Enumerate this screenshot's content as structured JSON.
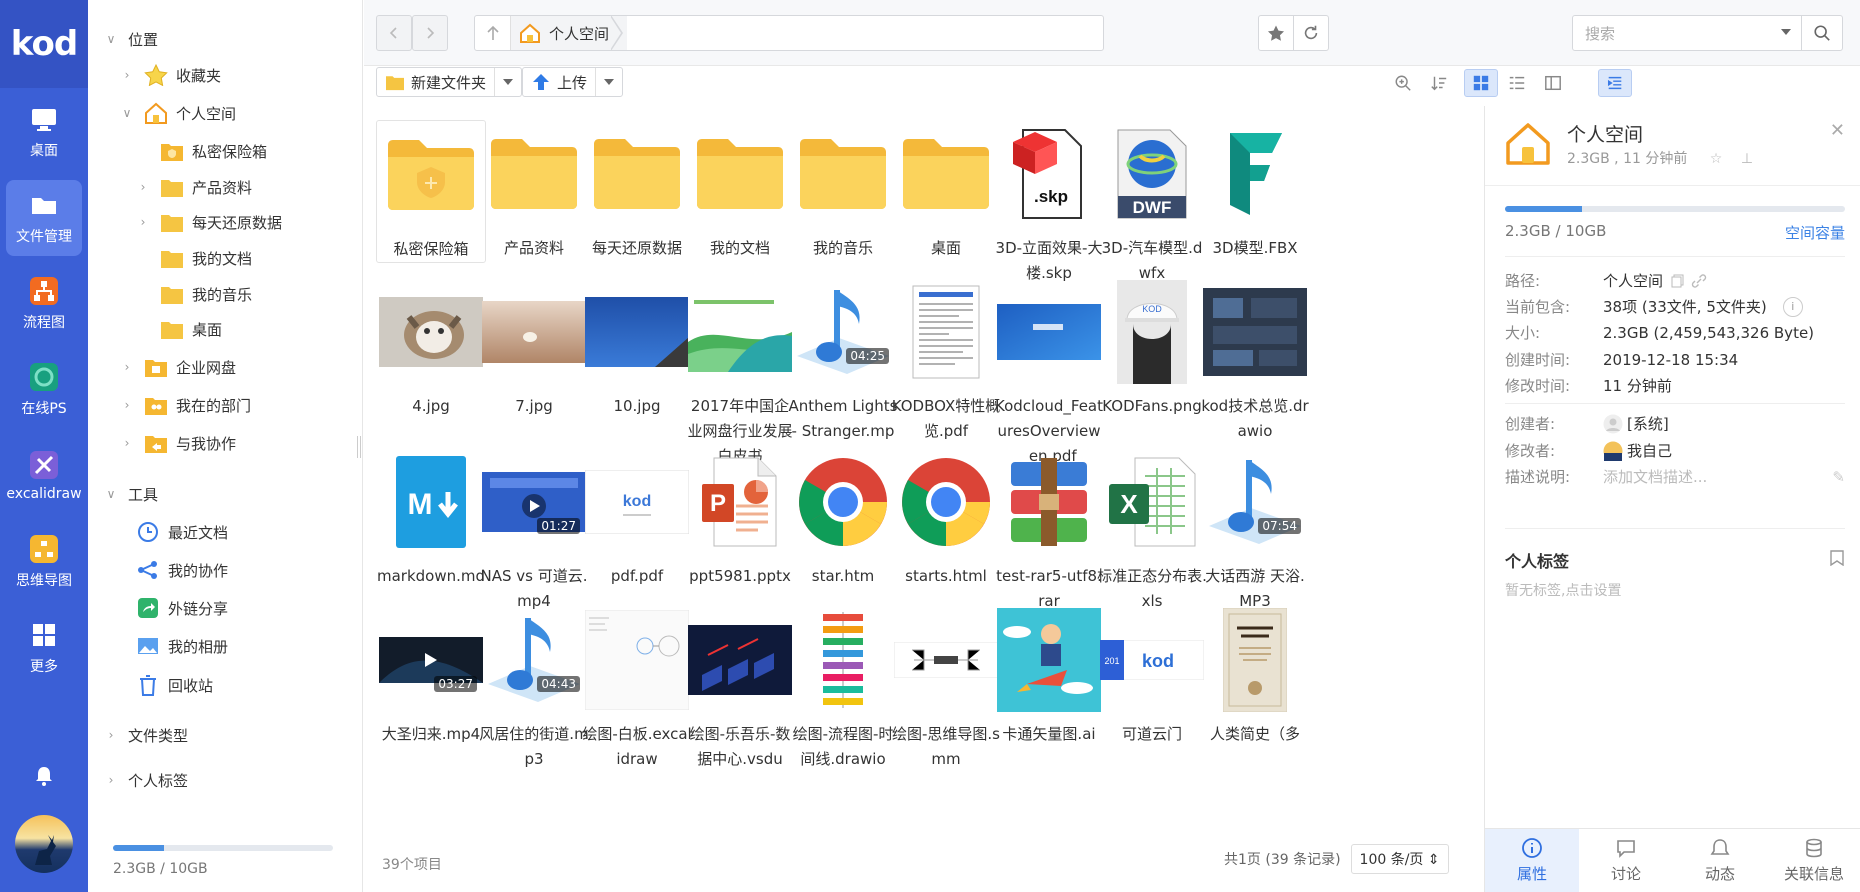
{
  "app": {
    "logo": "kod"
  },
  "appnav": {
    "items": [
      {
        "label": "桌面",
        "icon": "monitor-icon"
      },
      {
        "label": "文件管理",
        "icon": "folder-icon",
        "active": true
      },
      {
        "label": "流程图",
        "icon": "flowchart-icon"
      },
      {
        "label": "在线PS",
        "icon": "photoshop-icon"
      },
      {
        "label": "excalidraw",
        "icon": "excalidraw-icon"
      },
      {
        "label": "思维导图",
        "icon": "mindmap-icon"
      },
      {
        "label": "更多",
        "icon": "grid-icon"
      }
    ]
  },
  "tree": {
    "location_header": "位置",
    "favorites": "收藏夹",
    "personal_space": "个人空间",
    "children": [
      "私密保险箱",
      "产品资料",
      "每天还原数据",
      "我的文档",
      "我的音乐",
      "桌面"
    ],
    "enterprise_disk": "企业网盘",
    "my_department": "我在的部门",
    "collaborate_with_me": "与我协作",
    "tools_header": "工具",
    "tools": [
      "最近文档",
      "我的协作",
      "外链分享",
      "我的相册",
      "回收站"
    ],
    "file_types": "文件类型",
    "personal_tags": "个人标签",
    "quota_text": "2.3GB / 10GB",
    "quota_used_fraction": 0.23
  },
  "topbar": {
    "breadcrumb": "个人空间",
    "search_placeholder": "搜索"
  },
  "toolbar": {
    "new_folder": "新建文件夹",
    "upload": "上传"
  },
  "files": [
    {
      "name": "私密保险箱",
      "kind": "safe-folder"
    },
    {
      "name": "产品资料",
      "kind": "folder"
    },
    {
      "name": "每天还原数据",
      "kind": "folder"
    },
    {
      "name": "我的文档",
      "kind": "folder"
    },
    {
      "name": "我的音乐",
      "kind": "folder"
    },
    {
      "name": "桌面",
      "kind": "folder"
    },
    {
      "name": "3D-立面效果-大楼.skp",
      "kind": "skp"
    },
    {
      "name": "3D-汽车模型.dwfx",
      "kind": "dwf"
    },
    {
      "name": "3D模型.FBX",
      "kind": "fbx"
    },
    {
      "name": "4.jpg",
      "kind": "img-cat"
    },
    {
      "name": "7.jpg",
      "kind": "img-beach"
    },
    {
      "name": "10.jpg",
      "kind": "img-sky"
    },
    {
      "name": "2017年中国企业网盘行业发展白皮书",
      "kind": "img-report"
    },
    {
      "name": "Anthem Lights - Stranger.mp",
      "kind": "music",
      "badge": "04:25"
    },
    {
      "name": "KODBOX特性概览.pdf",
      "kind": "doc"
    },
    {
      "name": "Kodcloud_FeaturesOverview_en.pdf",
      "kind": "img-blue"
    },
    {
      "name": "KODFans.png",
      "kind": "img-hat"
    },
    {
      "name": "kod技术总览.drawio",
      "kind": "img-dark"
    },
    {
      "name": "markdown.md",
      "kind": "md"
    },
    {
      "name": "NAS vs 可道云.mp4",
      "kind": "video-blue",
      "badge": "01:27"
    },
    {
      "name": "pdf.pdf",
      "kind": "img-kod"
    },
    {
      "name": "ppt5981.pptx",
      "kind": "ppt"
    },
    {
      "name": "star.htm",
      "kind": "chrome"
    },
    {
      "name": "starts.html",
      "kind": "chrome"
    },
    {
      "name": "test-rar5-utf8.rar",
      "kind": "rar"
    },
    {
      "name": "标准正态分布表.xls",
      "kind": "xls"
    },
    {
      "name": "大话西游 天浴.MP3",
      "kind": "music",
      "badge": "07:54"
    },
    {
      "name": "大圣归来.mp4",
      "kind": "video-dark",
      "badge": "03:27"
    },
    {
      "name": "风居住的街道.mp3",
      "kind": "music",
      "badge": "04:43"
    },
    {
      "name": "绘图-白板.excalidraw",
      "kind": "img-board"
    },
    {
      "name": "绘图-乐吾乐-数据中心.vsdu",
      "kind": "img-datacenter"
    },
    {
      "name": "绘图-流程图-时间线.drawio",
      "kind": "img-timeline"
    },
    {
      "name": "绘图-思维导图.smm",
      "kind": "img-mindmap"
    },
    {
      "name": "卡通矢量图.ai",
      "kind": "img-cartoon"
    },
    {
      "name": "可道云门",
      "kind": "img-kodcloud"
    },
    {
      "name": "人类简史（多",
      "kind": "img-book"
    }
  ],
  "status": {
    "item_count": "39个项目",
    "pagination": "共1页 (39 条记录)",
    "per_page": "100 条/页"
  },
  "panel": {
    "title": "个人空间",
    "subtitle": "2.3GB , 11 分钟前",
    "quota_used": "2.3GB / 10GB",
    "quota_used_fraction": 0.23,
    "quota_link": "空间容量",
    "rows": [
      {
        "k": "路径:",
        "v": "个人空间"
      },
      {
        "k": "当前包含:",
        "v": "38项 (33文件, 5文件夹)"
      },
      {
        "k": "大小:",
        "v": "2.3GB (2,459,543,326 Byte)"
      },
      {
        "k": "创建时间:",
        "v": "2019-12-18 15:34"
      },
      {
        "k": "修改时间:",
        "v": "11 分钟前"
      }
    ],
    "creator_label": "创建者:",
    "creator": "[系统]",
    "modifier_label": "修改者:",
    "modifier": "我自己",
    "desc_label": "描述说明:",
    "desc_placeholder": "添加文档描述...",
    "tags_title": "个人标签",
    "tags_empty": "暂无标签,点击设置",
    "tabs": [
      "属性",
      "讨论",
      "动态",
      "关联信息"
    ]
  },
  "colors": {
    "nav_bg": "#3b5fd6",
    "accent": "#3b82e5",
    "folder": "#f5c542"
  }
}
